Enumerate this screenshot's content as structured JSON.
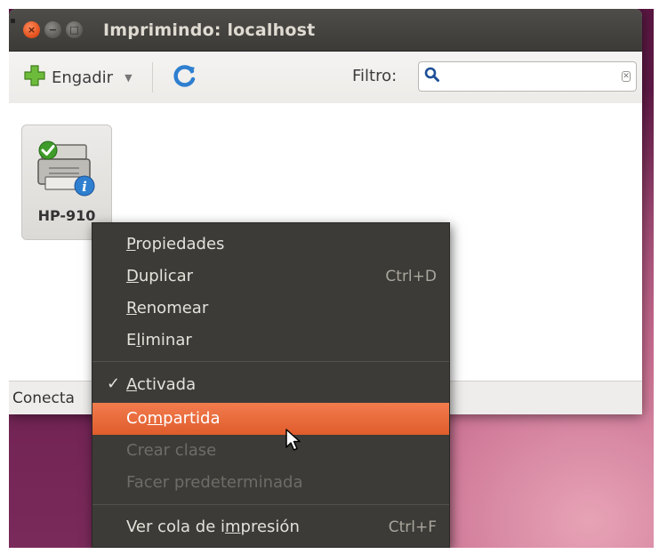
{
  "window": {
    "title": "Imprimindo: localhost",
    "controls": {
      "close": "×",
      "minimize": "−",
      "maximize": "□"
    }
  },
  "toolbar": {
    "add_label": "Engadir",
    "add_icon": "plus-icon",
    "dropdown_icon": "chevron-down-icon",
    "refresh_icon": "refresh-icon",
    "filter_label": "Filtro:",
    "filter_value": "",
    "filter_placeholder": ""
  },
  "printers": [
    {
      "name": "HP-910",
      "icon": "printer-icon",
      "status_icons": [
        "check-icon",
        "info-icon"
      ]
    }
  ],
  "statusbar": {
    "text": "Conecta"
  },
  "context_menu": {
    "items": [
      {
        "pre": "",
        "mn": "P",
        "post": "ropiedades",
        "shortcut": "",
        "enabled": true
      },
      {
        "pre": "",
        "mn": "D",
        "post": "uplicar",
        "shortcut": "Ctrl+D",
        "enabled": true
      },
      {
        "pre": "",
        "mn": "R",
        "post": "enomear",
        "shortcut": "",
        "enabled": true
      },
      {
        "pre": "E",
        "mn": "l",
        "post": "iminar",
        "shortcut": "",
        "enabled": true
      },
      {
        "pre": "",
        "mn": "A",
        "post": "ctivada",
        "shortcut": "",
        "enabled": true,
        "checked": true,
        "check_mark": "✓"
      },
      {
        "pre": "Co",
        "mn": "m",
        "post": "partida",
        "shortcut": "",
        "enabled": true,
        "highlighted": true
      },
      {
        "label": "Crear clase",
        "enabled": false
      },
      {
        "label": "Facer predeterminada",
        "enabled": false
      },
      {
        "pre": "Ver cola de i",
        "mn": "m",
        "post": "presión",
        "shortcut": "Ctrl+F",
        "enabled": true
      }
    ]
  },
  "colors": {
    "titlebar": "#3d3b37",
    "menu_background": "#3c3b37",
    "menu_highlight": "#e05c2c",
    "close_button": "#e04e1b",
    "desktop": "#5a1742"
  }
}
